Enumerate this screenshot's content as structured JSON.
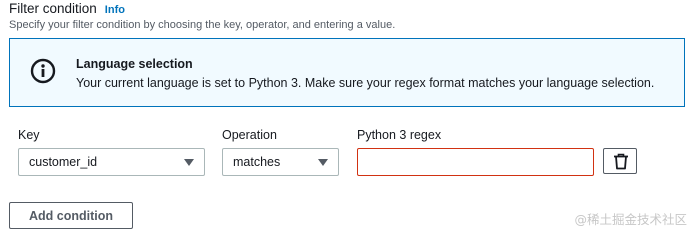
{
  "header": {
    "title": "Filter condition",
    "info_link": "Info",
    "description": "Specify your filter condition by choosing the key, operator, and entering a value."
  },
  "alert": {
    "icon": "info-icon",
    "title": "Language selection",
    "message": "Your current language is set to Python 3. Make sure your regex format matches your language selection.",
    "accent_color": "#0073bb",
    "background": "#f1faff"
  },
  "form": {
    "key": {
      "label": "Key",
      "value": "customer_id"
    },
    "operation": {
      "label": "Operation",
      "value": "matches"
    },
    "regex": {
      "label": "Python 3 regex",
      "value": "",
      "border_color": "#d13212"
    },
    "remove_icon": "trash-icon"
  },
  "actions": {
    "add_condition_label": "Add condition"
  },
  "watermark": {
    "text": "@稀土掘金技术社区"
  }
}
